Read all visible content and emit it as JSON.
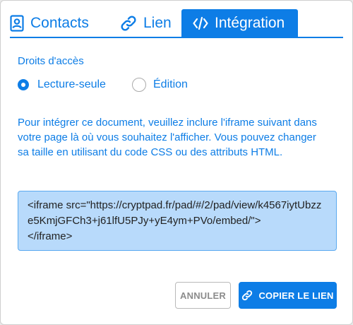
{
  "tabs": [
    {
      "label": "Contacts",
      "icon": "contacts-icon",
      "active": false
    },
    {
      "label": "Lien",
      "icon": "link-icon",
      "active": false
    },
    {
      "label": "Intégration",
      "icon": "code-icon",
      "active": true
    }
  ],
  "access": {
    "title": "Droits d'accès",
    "options": [
      {
        "label": "Lecture-seule",
        "selected": true
      },
      {
        "label": "Édition",
        "selected": false
      }
    ]
  },
  "description": "Pour intégrer ce document, veuillez inclure l'iframe suivant dans votre page là où vous souhaitez l'afficher. Vous pouvez changer sa taille en utilisant du code CSS ou des attributs HTML.",
  "embed_code": "<iframe src=\"https://cryptpad.fr/pad/#/2/pad/view/k4567iytUbzze5KmjGFCh3+j61lfU5PJy+yE4ym+PVo/embed/\">\n</iframe>",
  "buttons": {
    "cancel_label": "ANNULER",
    "copy_label": "COPIER LE LIEN",
    "copy_icon": "link-icon"
  },
  "colors": {
    "accent": "#0d7de6",
    "code_bg": "#b8dafb"
  }
}
